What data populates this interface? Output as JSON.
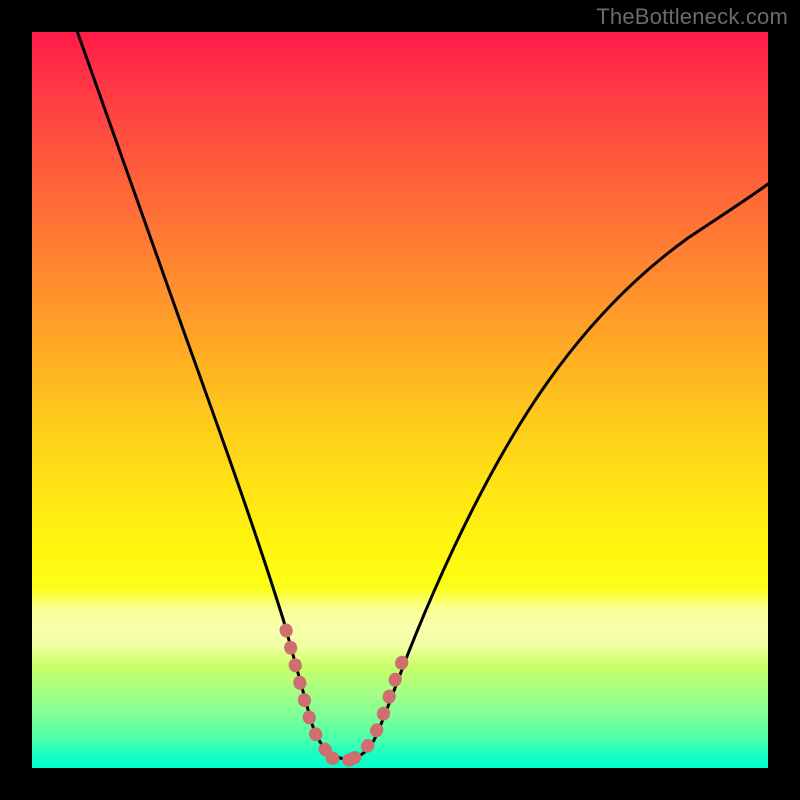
{
  "watermark": "TheBottleneck.com",
  "colors": {
    "frame": "#000000",
    "curve": "#000000",
    "highlight": "#d07070",
    "watermark_text": "#6b6b6b"
  },
  "chart_data": {
    "type": "line",
    "title": "",
    "xlabel": "",
    "ylabel": "",
    "xlim": [
      0,
      100
    ],
    "ylim": [
      0,
      100
    ],
    "grid": false,
    "legend": false,
    "series": [
      {
        "name": "left-branch",
        "x": [
          6,
          10,
          14,
          18,
          22,
          26,
          30,
          34,
          36
        ],
        "y": [
          100,
          86,
          73,
          60,
          47,
          34,
          21,
          8,
          4
        ]
      },
      {
        "name": "trough",
        "x": [
          36,
          38,
          40,
          42,
          44,
          46,
          48
        ],
        "y": [
          4,
          2,
          1.2,
          1,
          1.2,
          2,
          4
        ]
      },
      {
        "name": "right-branch",
        "x": [
          48,
          52,
          58,
          64,
          70,
          76,
          82,
          88,
          94,
          100
        ],
        "y": [
          4,
          10,
          20,
          29,
          37,
          44,
          51,
          57,
          63,
          68
        ]
      },
      {
        "name": "highlight-left",
        "x": [
          34,
          35,
          36,
          37,
          38,
          39,
          40
        ],
        "y": [
          8,
          6,
          4.2,
          3,
          2.2,
          1.6,
          1.2
        ]
      },
      {
        "name": "highlight-bottom",
        "x": [
          40,
          41,
          42,
          43,
          44
        ],
        "y": [
          1.2,
          1.05,
          1.0,
          1.05,
          1.2
        ]
      },
      {
        "name": "highlight-right",
        "x": [
          44,
          45,
          46,
          47,
          48,
          49,
          50
        ],
        "y": [
          1.2,
          1.6,
          2.2,
          3,
          4.2,
          5.6,
          7.2
        ]
      }
    ],
    "annotations": [
      {
        "text": "TheBottleneck.com",
        "position": "top-right"
      }
    ]
  }
}
